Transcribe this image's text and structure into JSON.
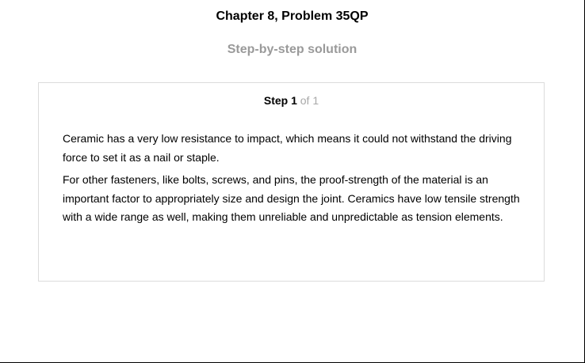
{
  "header": {
    "chapter_title": "Chapter 8, Problem 35QP",
    "subtitle": "Step-by-step solution"
  },
  "step": {
    "label": "Step 1",
    "of_text": "of 1",
    "paragraphs": [
      "Ceramic has a very low resistance to impact, which means it could not withstand the driving force to set it as a nail or staple.",
      "For other fasteners, like bolts, screws, and pins, the proof-strength of the material is an important factor to appropriately size and design the joint. Ceramics have low tensile strength with a wide range as well, making them unreliable and unpredictable as tension elements."
    ]
  },
  "colors": {
    "subtitle": "#9a9a9a",
    "card_border": "#dcdcdc",
    "step_of": "#a8a8a8"
  }
}
